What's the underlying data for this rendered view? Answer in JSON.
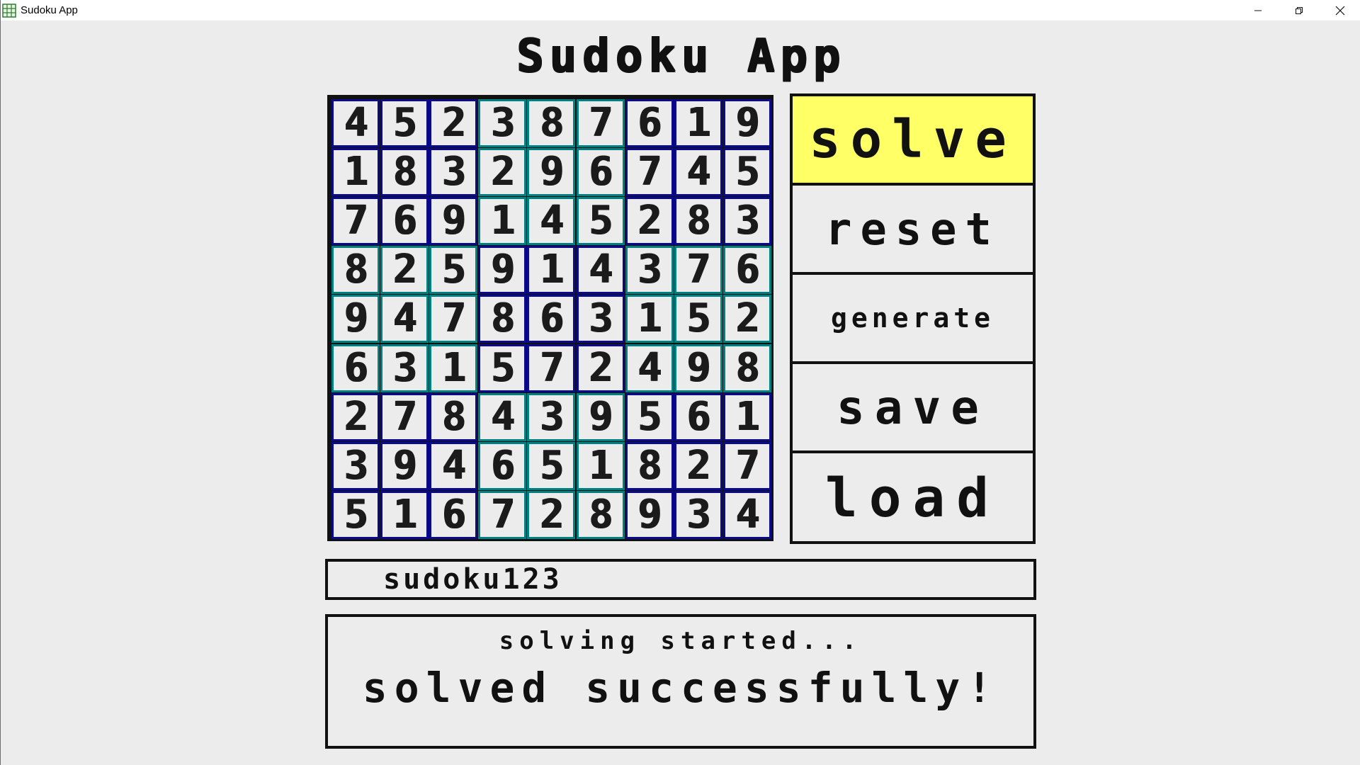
{
  "window": {
    "title": "Sudoku App",
    "icon": "grid-icon",
    "controls": [
      "minimize-icon",
      "restore-icon",
      "close-icon"
    ]
  },
  "header": {
    "title": "Sudoku App"
  },
  "board": {
    "rows": [
      [
        4,
        5,
        2,
        3,
        8,
        7,
        6,
        1,
        9
      ],
      [
        1,
        8,
        3,
        2,
        9,
        6,
        7,
        4,
        5
      ],
      [
        7,
        6,
        9,
        1,
        4,
        5,
        2,
        8,
        3
      ],
      [
        8,
        2,
        5,
        9,
        1,
        4,
        3,
        7,
        6
      ],
      [
        9,
        4,
        7,
        8,
        6,
        3,
        1,
        5,
        2
      ],
      [
        6,
        3,
        1,
        5,
        7,
        2,
        4,
        9,
        8
      ],
      [
        2,
        7,
        8,
        4,
        3,
        9,
        5,
        6,
        1
      ],
      [
        3,
        9,
        4,
        6,
        5,
        1,
        8,
        2,
        7
      ],
      [
        5,
        1,
        6,
        7,
        2,
        8,
        9,
        3,
        4
      ]
    ],
    "colors": {
      "blue_box": "#0a0a8a",
      "teal_box": "#008080",
      "outer": "#111111",
      "cell_bg": "#ececec"
    }
  },
  "buttons": {
    "solve": "solve",
    "reset": "reset",
    "generate": "generate",
    "save": "save",
    "load": "load",
    "active": "solve",
    "active_color": "#ffff66"
  },
  "filename": {
    "value": "sudoku123"
  },
  "log": {
    "line1": "solving started...",
    "line2": "solved successfully!"
  }
}
